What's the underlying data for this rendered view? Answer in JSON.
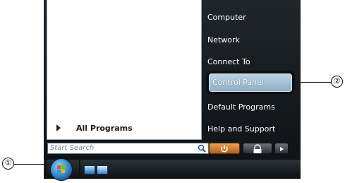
{
  "start_menu": {
    "left_pane": {
      "all_programs_label": "All Programs",
      "search_placeholder": "Start Search"
    },
    "right_pane": {
      "items": [
        {
          "label": "Computer"
        },
        {
          "label": "Network"
        },
        {
          "label": "Connect To"
        },
        {
          "label": "Control Panel",
          "highlighted": true
        },
        {
          "label": "Default Programs"
        },
        {
          "label": "Help and Support"
        }
      ]
    }
  },
  "callouts": {
    "one": "①",
    "two": "②"
  },
  "icons": {
    "search": "search-icon",
    "power": "power-icon",
    "lock": "lock-icon",
    "arrow": "arrow-right-icon",
    "start": "windows-orb-icon"
  }
}
